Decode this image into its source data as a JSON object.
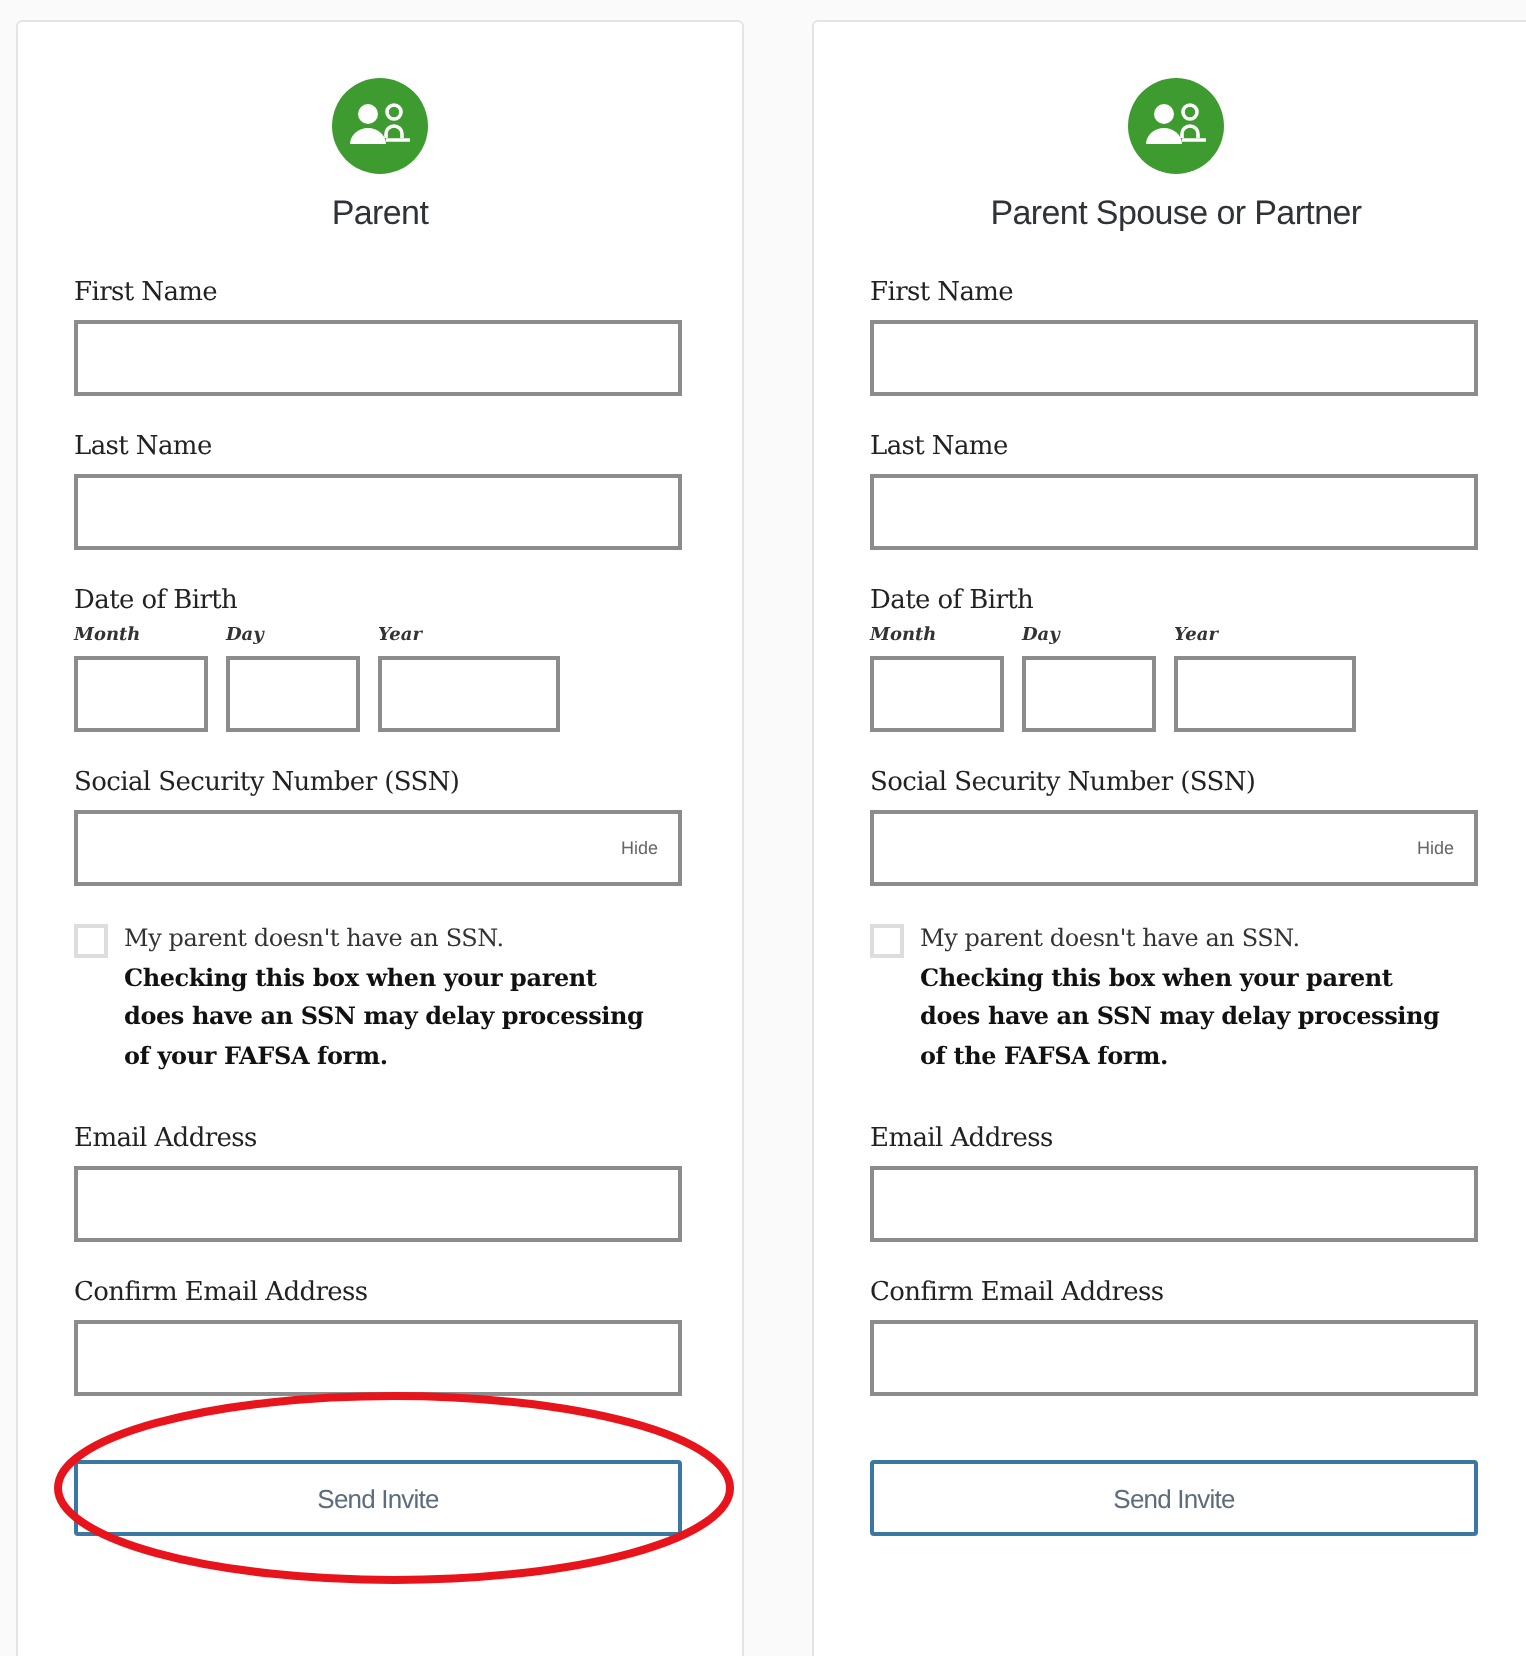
{
  "cards": [
    {
      "title": "Parent",
      "fields": [
        {
          "kind": "text",
          "label": "First Name"
        },
        {
          "kind": "text",
          "label": "Last Name"
        },
        {
          "kind": "date",
          "label": "Date of Birth",
          "parts": [
            "Month",
            "Day",
            "Year"
          ]
        },
        {
          "kind": "ssn",
          "label": "Social Security Number (SSN)",
          "toggle": "Hide"
        },
        {
          "kind": "checkbox",
          "checked": false,
          "text": "My parent doesn't have an SSN. **Checking this box when your parent does have an SSN may delay processing of your FAFSA form.**"
        },
        {
          "kind": "text",
          "label": "Email Address"
        },
        {
          "kind": "text",
          "label": "Confirm Email Address"
        }
      ],
      "button": {
        "label": "Send Invite",
        "circled": true
      }
    },
    {
      "title": "Parent Spouse or Partner",
      "fields": [
        {
          "kind": "text",
          "label": "First Name"
        },
        {
          "kind": "text",
          "label": "Last Name"
        },
        {
          "kind": "date",
          "label": "Date of Birth",
          "parts": [
            "Month",
            "Day",
            "Year"
          ]
        },
        {
          "kind": "ssn",
          "label": "Social Security Number (SSN)",
          "toggle": "Hide"
        },
        {
          "kind": "checkbox",
          "checked": false,
          "text": "My parent doesn't have an SSN. **Checking this box when your parent does have an SSN may delay processing of the FAFSA form.**"
        },
        {
          "kind": "text",
          "label": "Email Address"
        },
        {
          "kind": "text",
          "label": "Confirm Email Address"
        }
      ],
      "button": {
        "label": "Send Invite",
        "circled": false
      }
    }
  ]
}
